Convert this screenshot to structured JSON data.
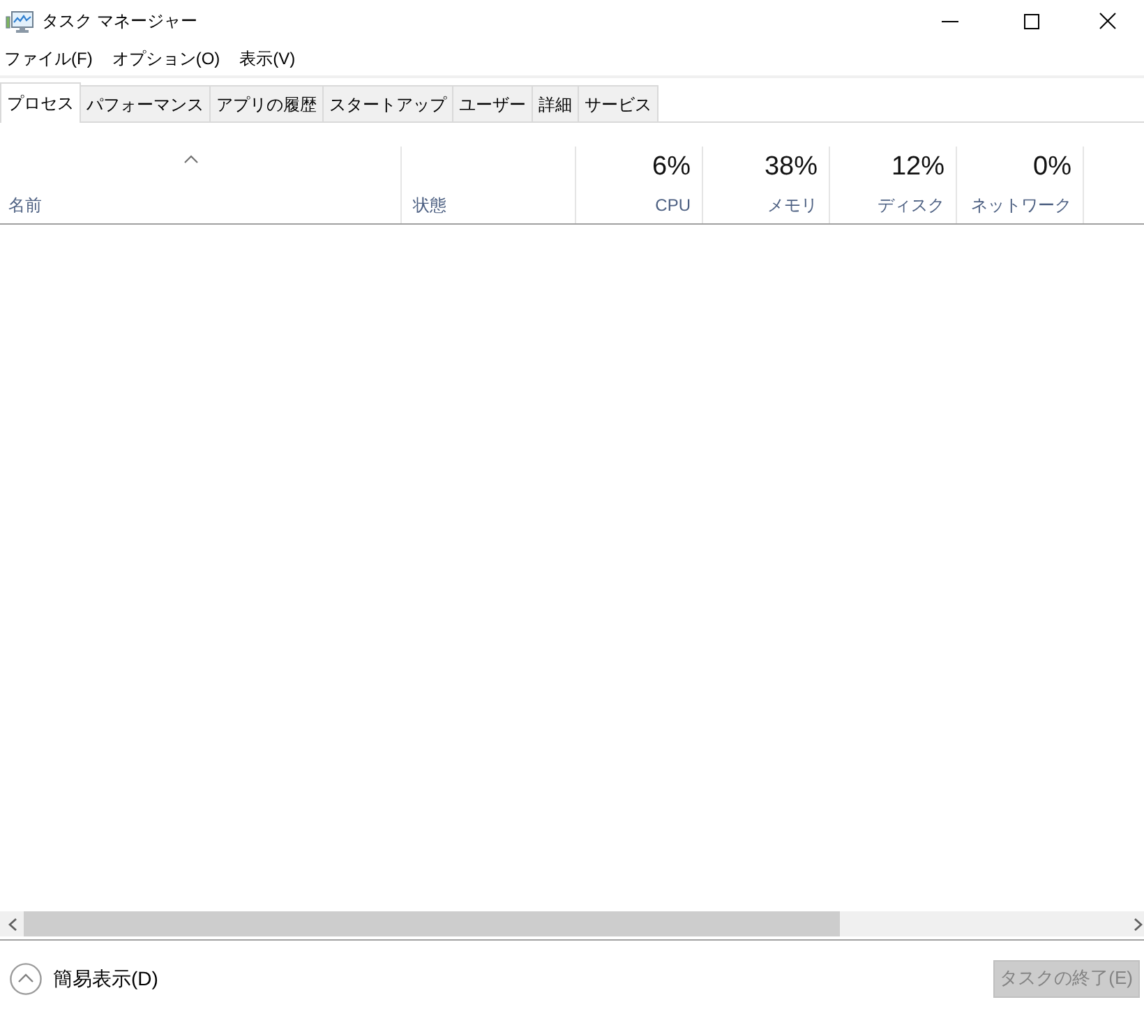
{
  "window": {
    "title": "タスク マネージャー"
  },
  "menu": [
    {
      "label": "ファイル(F)"
    },
    {
      "label": "オプション(O)"
    },
    {
      "label": "表示(V)"
    }
  ],
  "tabs": [
    {
      "label": "プロセス",
      "selected": true
    },
    {
      "label": "パフォーマンス",
      "selected": false
    },
    {
      "label": "アプリの履歴",
      "selected": false
    },
    {
      "label": "スタートアップ",
      "selected": false
    },
    {
      "label": "ユーザー",
      "selected": false
    },
    {
      "label": "詳細",
      "selected": false
    },
    {
      "label": "サービス",
      "selected": false
    }
  ],
  "table": {
    "columns": [
      {
        "label": "名前",
        "sorted": true
      },
      {
        "label": "状態",
        "sorted": false
      },
      {
        "label": "CPU",
        "usage": "6%",
        "sorted": false
      },
      {
        "label": "メモリ",
        "usage": "38%",
        "sorted": false
      },
      {
        "label": "ディスク",
        "usage": "12%",
        "sorted": false
      },
      {
        "label": "ネットワーク",
        "usage": "0%",
        "sorted": false
      }
    ]
  },
  "footer": {
    "fewer_details": "簡易表示(D)",
    "end_task": {
      "label": "タスクの終了(E)",
      "disabled": true
    }
  }
}
